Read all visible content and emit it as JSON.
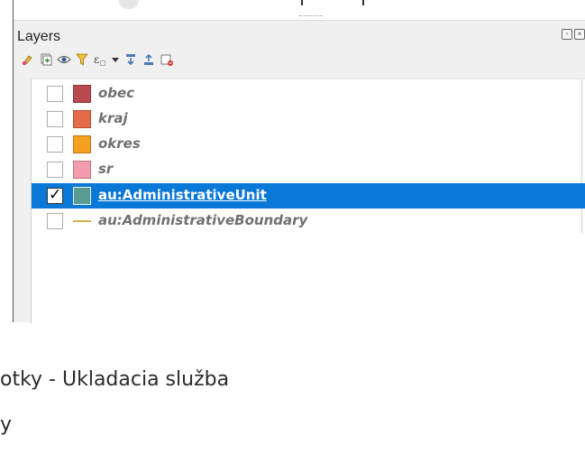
{
  "layers_panel": {
    "title": "Layers",
    "toolbar_icons": [
      "style-manager-icon",
      "add-group-icon",
      "visibility-eye-icon",
      "filter-icon",
      "expression-filter-icon",
      "dropdown-arrow-icon",
      "expand-all-icon",
      "collapse-all-icon",
      "remove-layer-icon"
    ],
    "layers": [
      {
        "name": "obec",
        "checked": false,
        "symbol": "fill",
        "color": "#b94a4f",
        "selected": false
      },
      {
        "name": "kraj",
        "checked": false,
        "symbol": "fill",
        "color": "#e56c4a",
        "selected": false
      },
      {
        "name": "okres",
        "checked": false,
        "symbol": "fill",
        "color": "#f5a020",
        "selected": false
      },
      {
        "name": "sr",
        "checked": false,
        "symbol": "fill",
        "color": "#f29cad",
        "selected": false
      },
      {
        "name": "au:AdministrativeUnit",
        "checked": true,
        "symbol": "fill",
        "color": "#5a9b8f",
        "selected": true
      },
      {
        "name": "au:AdministrativeBoundary",
        "checked": false,
        "symbol": "line",
        "color": "#d8b150",
        "selected": false
      }
    ]
  },
  "below_text": {
    "line1": "otky - Ukladacia služba",
    "line2": "y"
  },
  "colors": {
    "selection": "#0a78d7",
    "panel_bg": "#f0f0f0"
  }
}
